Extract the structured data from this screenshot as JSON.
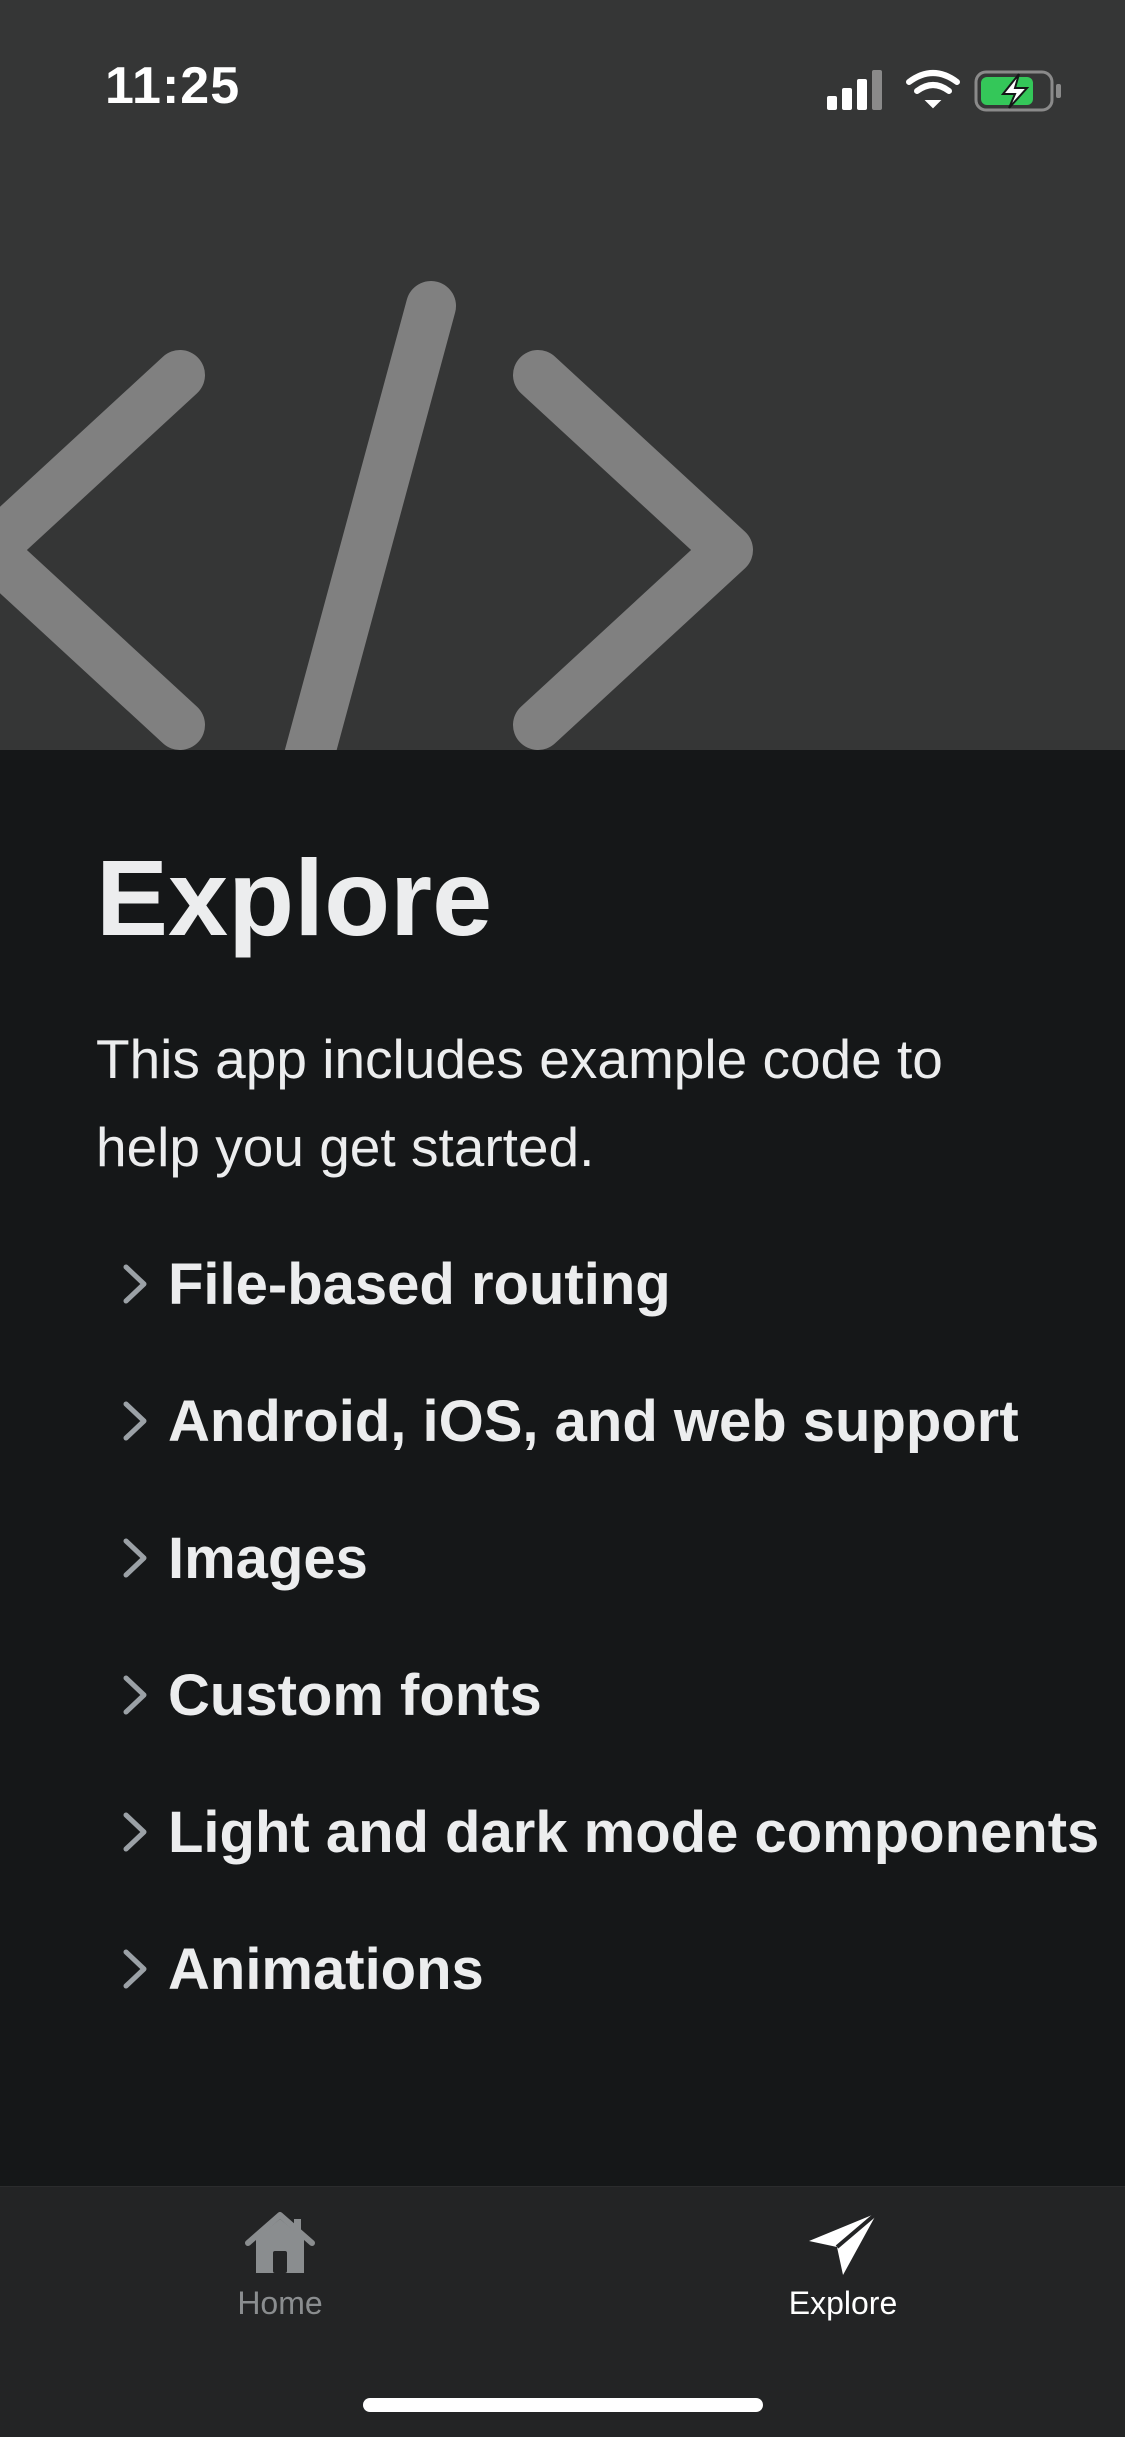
{
  "status_bar": {
    "time": "11:25",
    "icons": [
      "signal-icon",
      "wifi-icon",
      "battery-charging-icon"
    ]
  },
  "header": {
    "icon": "code-icon"
  },
  "main": {
    "title": "Explore",
    "intro": "This app includes example code to help you get started.",
    "items": [
      {
        "label": "File-based routing"
      },
      {
        "label": "Android, iOS, and web support"
      },
      {
        "label": "Images"
      },
      {
        "label": "Custom fonts"
      },
      {
        "label": "Light and dark mode components"
      },
      {
        "label": "Animations"
      }
    ]
  },
  "tabbar": {
    "tabs": [
      {
        "label": "Home",
        "icon": "house-icon",
        "active": false
      },
      {
        "label": "Explore",
        "icon": "paper-plane-icon",
        "active": true
      }
    ]
  },
  "colors": {
    "header_bg": "#353636",
    "content_bg": "#151718",
    "tabbar_bg": "#232425",
    "text": "#ECEDEE",
    "battery": "#34C759",
    "inactive_tab": "#8A8D8F"
  }
}
